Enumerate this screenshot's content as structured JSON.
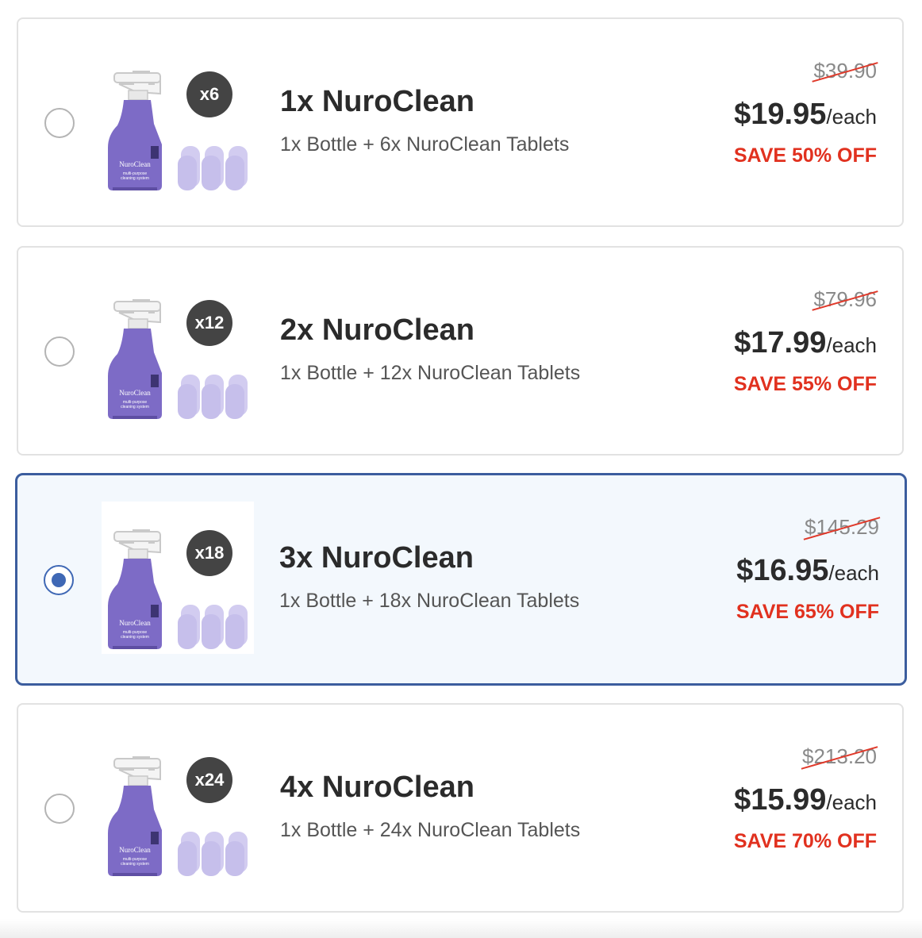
{
  "colors": {
    "accent": "#3f68b5",
    "selected_bg": "#f3f8fd",
    "save_red": "#e1311f",
    "badge_bg": "#444444",
    "bottle_purple": "#7d6bc6",
    "tablet_lavender": "#d2ccf0"
  },
  "offers": [
    {
      "badge": "x6",
      "title": "1x NuroClean",
      "subtitle": "1x Bottle + 6x NuroClean Tablets",
      "original_price": "$39.90",
      "price": "$19.95",
      "per": "/each",
      "save": "SAVE 50% OFF",
      "selected": false
    },
    {
      "badge": "x12",
      "title": "2x NuroClean",
      "subtitle": "1x Bottle + 12x NuroClean Tablets",
      "original_price": "$79.96",
      "price": "$17.99",
      "per": "/each",
      "save": "SAVE 55% OFF",
      "selected": false
    },
    {
      "badge": "x18",
      "title": "3x NuroClean",
      "subtitle": "1x Bottle + 18x NuroClean Tablets",
      "original_price": "$145.29",
      "price": "$16.95",
      "per": "/each",
      "save": "SAVE 65% OFF",
      "selected": true
    },
    {
      "badge": "x24",
      "title": "4x NuroClean",
      "subtitle": "1x Bottle + 24x NuroClean Tablets",
      "original_price": "$213.20",
      "price": "$15.99",
      "per": "/each",
      "save": "SAVE 70% OFF",
      "selected": false
    }
  ],
  "product_image": {
    "label": "NuroClean",
    "tagline_1": "multi-purpose",
    "tagline_2": "cleaning system"
  }
}
